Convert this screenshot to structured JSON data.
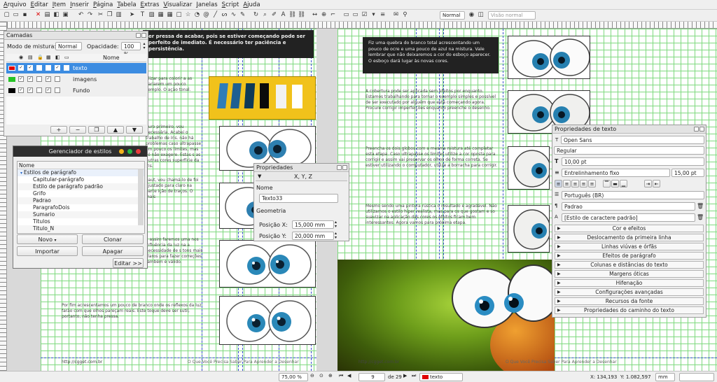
{
  "menu": [
    "Arquivo",
    "Editar",
    "Item",
    "Inserir",
    "Página",
    "Tabela",
    "Extras",
    "Visualizar",
    "Janelas",
    "Script",
    "Ajuda"
  ],
  "toolbar": {
    "mode": "Normal",
    "preview": "Visão normal"
  },
  "page_left": {
    "dark_box": "er pressa de acabar, pois se estiver começando pode ser perfeito de imediato. É necessário ter paciência e persistência.",
    "p1": "tilizar para colorir a as variarem um pouco xemplo. O ação tonal.",
    "p2": "guro primeiro, vou necessária. Acabei o trabalho de íris. não há problemas caso ultrapasse um pouco os limites, mas só não exagere. Estas s as outras cores superfície da íris.",
    "p3": "gaut, vou chamá-lo de foi ajustado para claro na parte ição de traços. O mais",
    "p4": "a assim faremos uma nos influência da luz na a necessidade de s tons mais claros para fazer correções também é válido.",
    "p5": "Por fim acrescentamos um pouco de branco onde os reflexos da luz farão com que olhos pareçam reais. Este toque deve ser sutil, portanto, não tenha pressa.",
    "footer_url": "http://cgget.com.br",
    "footer_title": "O Que Você Precisa Saber Para Aprender a Desenhar"
  },
  "page_right": {
    "dark_box": "Fiz uma quebra do branco total acrescentando um pouco de ocre e uma pouco de azul na mistura. Vale lembrar que não deixaremos a cor do esboço aparecer. O esboço dará lugar às novas cores.",
    "p1": "A cobertura pode ser aplicada sem efeitos por enquanto. Estamos trabalhando para tornar o exemplo simples e possível de ser executado por alguém que está começando agora. Procure corrigir imperfeições enquanto preenche o desenho.",
    "p2": "Preencha os dois globos com a mesma mistura até completar esta etapa. Caso ultrapasse os limites utilize a cor oposta para corrigir e assim vai preservar os olhos de forma correta. Se estiver utilizando o computador, utilize a borracha para corrigir.",
    "p3": "Mesmo sendo uma pintura rústica o resultado é agradável. Não utilizamos o estilo hiper realista, mas para os que gostam e so suavizar na aplicação das cores os efeitos ficam bem interessantes. Agora vamos para próxima etapa.",
    "footer_url": "http://cgget.com.br",
    "footer_title": "O Que Você Precisa Saber Para Aprender a Desenhar"
  },
  "layers": {
    "title": "Camadas",
    "blend_label": "Modo de mistura:",
    "blend_value": "Normal",
    "opacity_label": "Opacidade:",
    "opacity_value": "100 %",
    "col_name": "Nome",
    "items": [
      {
        "name": "texto",
        "color": "#e00000"
      },
      {
        "name": "imagens",
        "color": "#27c427"
      },
      {
        "name": "Fundo",
        "color": "#000000"
      }
    ]
  },
  "styles": {
    "title": "Gerenciador de estilos",
    "col_name": "Nome",
    "group": "Estilos de parágrafo",
    "items": [
      "Capitular-parágrafo",
      "Estilo de parágrafo padrão",
      "Grifo",
      "Padrao",
      "ParagrafoDois",
      "Sumario",
      "Titulos",
      "Titulo_N"
    ],
    "btn_new": "Novo",
    "btn_clone": "Clonar",
    "btn_import": "Importar",
    "btn_delete": "Apagar",
    "btn_edit": "Editar >>"
  },
  "props": {
    "title": "Propriedades",
    "tab": "X, Y, Z",
    "name_label": "Nome",
    "name_value": "Texto33",
    "geom_label": "Geometria",
    "x_label": "Posição X:",
    "x_value": "15,000 mm",
    "y_label": "Posição Y:",
    "y_value": "20,000 mm"
  },
  "textprops": {
    "title": "Propriedades de texto",
    "font": "Open Sans",
    "style": "Regular",
    "size": "10,00 pt",
    "leading_mode": "Entrelinhamento fixo",
    "leading": "15,00 pt",
    "language": "Português (BR)",
    "para_style": "Padrao",
    "char_style": "[Estilo de caractere padrão]",
    "sections": [
      "Cor e efeitos",
      "Deslocamento da primeira linha",
      "Linhas viúvas e órfãs",
      "Efeitos de parágrafo",
      "Colunas e distâncias do texto",
      "Margens óticas",
      "Hifenação",
      "Configurações avançadas",
      "Recursos da fonte",
      "Propriedades do caminho do texto"
    ]
  },
  "status": {
    "zoom": "75,00 %",
    "page": "9",
    "of": "de 29",
    "layer": "texto",
    "x": "X: 134,193",
    "y": "Y: 1.082,597",
    "unit": "mm"
  }
}
